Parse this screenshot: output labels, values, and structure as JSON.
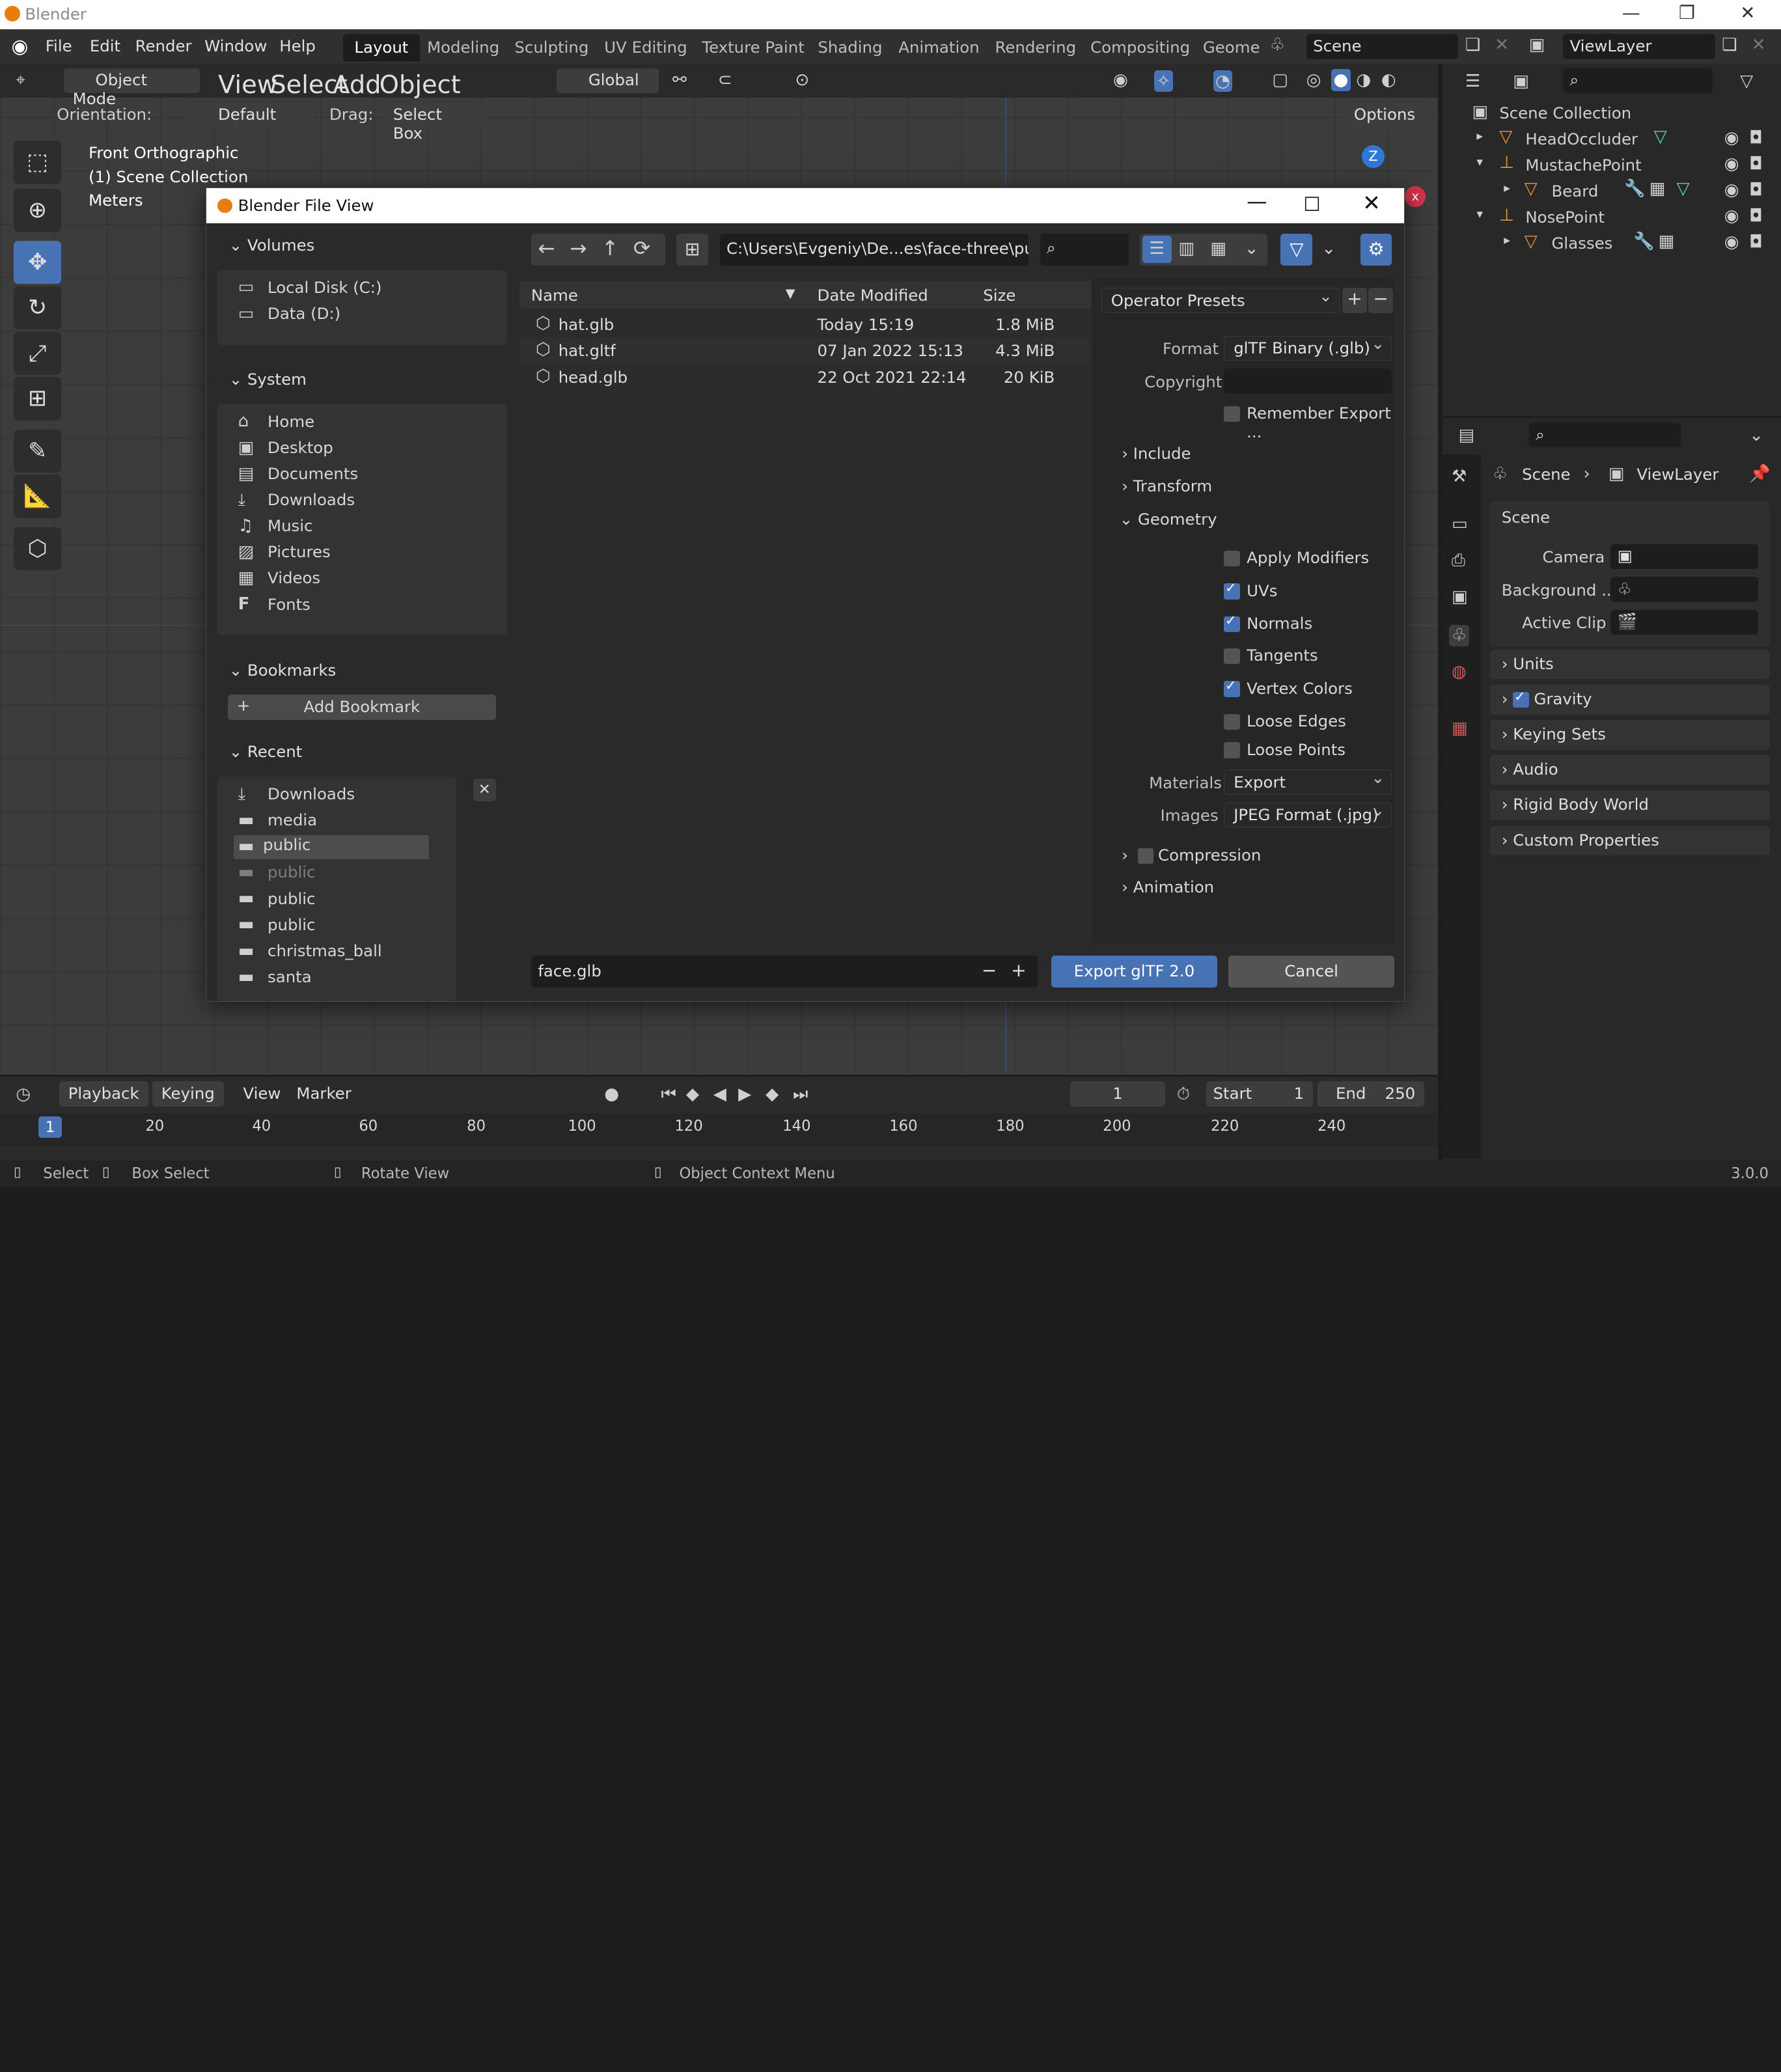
{
  "window": {
    "title": "Blender",
    "minimize": "—",
    "maximize": "❐",
    "close": "✕"
  },
  "menu": [
    "File",
    "Edit",
    "Render",
    "Window",
    "Help"
  ],
  "workspaces": [
    "Layout",
    "Modeling",
    "Sculpting",
    "UV Editing",
    "Texture Paint",
    "Shading",
    "Animation",
    "Rendering",
    "Compositing",
    "Geome"
  ],
  "scene_name": "Scene",
  "view_layer": "ViewLayer",
  "viewport_header": {
    "mode": "Object Mode",
    "menus": [
      "View",
      "Select",
      "Add",
      "Object"
    ],
    "transform": "Global",
    "orientation_label": "Orientation:",
    "orientation_value": "Default",
    "drag_label": "Drag:",
    "drag_value": "Select Box",
    "options": "Options"
  },
  "viewport_overlay": {
    "line1": "Front Orthographic",
    "line2": "(1) Scene Collection",
    "line3": "Meters",
    "gizmo_axis": "Z"
  },
  "outliner": {
    "root": "Scene Collection",
    "items": [
      {
        "label": "HeadOccluder",
        "expand": "▸"
      },
      {
        "label": "MustachePoint",
        "expand": "▾"
      },
      {
        "label": "Beard",
        "expand": "▸"
      },
      {
        "label": "NosePoint",
        "expand": "▾"
      },
      {
        "label": "Glasses",
        "expand": "▸"
      }
    ]
  },
  "properties": {
    "breadcrumb_scene": "Scene",
    "breadcrumb_layer": "ViewLayer",
    "panel_title": "Scene",
    "camera_label": "Camera",
    "background_label": "Background ...",
    "active_clip_label": "Active Clip",
    "panels": [
      "Units",
      "Gravity",
      "Keying Sets",
      "Audio",
      "Rigid Body World",
      "Custom Properties"
    ]
  },
  "timeline": {
    "menus": [
      "Playback",
      "Keying",
      "View",
      "Marker"
    ],
    "current_frame": "1",
    "start_label": "Start",
    "start": "1",
    "end_label": "End",
    "end": "250",
    "ticks": [
      "1",
      "20",
      "40",
      "60",
      "80",
      "100",
      "120",
      "140",
      "160",
      "180",
      "200",
      "220",
      "240"
    ]
  },
  "statusbar": {
    "select": "Select",
    "box_select": "Box Select",
    "rotate": "Rotate View",
    "context": "Object Context Menu",
    "version": "3.0.0"
  },
  "dialog": {
    "title": "Blender File View",
    "path": "C:\\Users\\Evgeniy\\De...es\\face-three\\public\\",
    "volumes_title": "Volumes",
    "volumes": [
      "Local Disk (C:)",
      "Data (D:)"
    ],
    "system_title": "System",
    "system": [
      "Home",
      "Desktop",
      "Documents",
      "Downloads",
      "Music",
      "Pictures",
      "Videos",
      "Fonts"
    ],
    "bookmarks_title": "Bookmarks",
    "add_bookmark": "Add Bookmark",
    "recent_title": "Recent",
    "recent": [
      "Downloads",
      "media",
      "public",
      "public",
      "public",
      "public",
      "christmas_ball",
      "santa"
    ],
    "columns": {
      "name": "Name",
      "date": "Date Modified",
      "size": "Size"
    },
    "files": [
      {
        "name": "hat.glb",
        "date": "Today 15:19",
        "size": "1.8 MiB"
      },
      {
        "name": "hat.gltf",
        "date": "07 Jan 2022 15:13",
        "size": "4.3 MiB"
      },
      {
        "name": "head.glb",
        "date": "22 Oct 2021 22:14",
        "size": "20 KiB"
      }
    ],
    "filename": "face.glb",
    "export_button": "Export glTF 2.0",
    "cancel_button": "Cancel",
    "operator_presets": "Operator Presets",
    "format_label": "Format",
    "format_value": "glTF Binary (.glb)",
    "copyright_label": "Copyright",
    "remember": "Remember Export ...",
    "include": "Include",
    "transform": "Transform",
    "geometry": "Geometry",
    "geom_options": [
      {
        "label": "Apply Modifiers",
        "checked": false
      },
      {
        "label": "UVs",
        "checked": true
      },
      {
        "label": "Normals",
        "checked": true
      },
      {
        "label": "Tangents",
        "checked": false
      },
      {
        "label": "Vertex Colors",
        "checked": true
      },
      {
        "label": "Loose Edges",
        "checked": false
      },
      {
        "label": "Loose Points",
        "checked": false
      }
    ],
    "materials_label": "Materials",
    "materials_value": "Export",
    "images_label": "Images",
    "images_value": "JPEG Format (.jpg)",
    "compression": "Compression",
    "animation": "Animation"
  },
  "colors": {
    "accent": "#4772b3",
    "orange": "#e87d0d",
    "bg": "#303030"
  }
}
